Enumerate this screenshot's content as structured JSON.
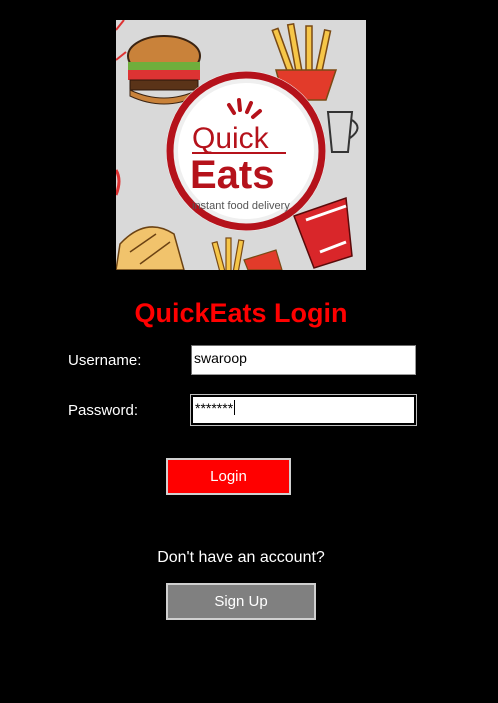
{
  "brand": {
    "logo_word1": "Quick",
    "logo_word2": "Eats",
    "logo_tagline": "instant food delivery",
    "accent_color": "#b5121b"
  },
  "page": {
    "title": "QuickEats Login",
    "title_color": "#ff0000"
  },
  "form": {
    "username_label": "Username:",
    "username_value": "swaroop",
    "password_label": "Password:",
    "password_value": "*******",
    "login_label": "Login",
    "login_color": "#ff0000"
  },
  "signup": {
    "prompt": "Don't have an account?",
    "button_label": "Sign Up",
    "button_color": "#808080"
  }
}
